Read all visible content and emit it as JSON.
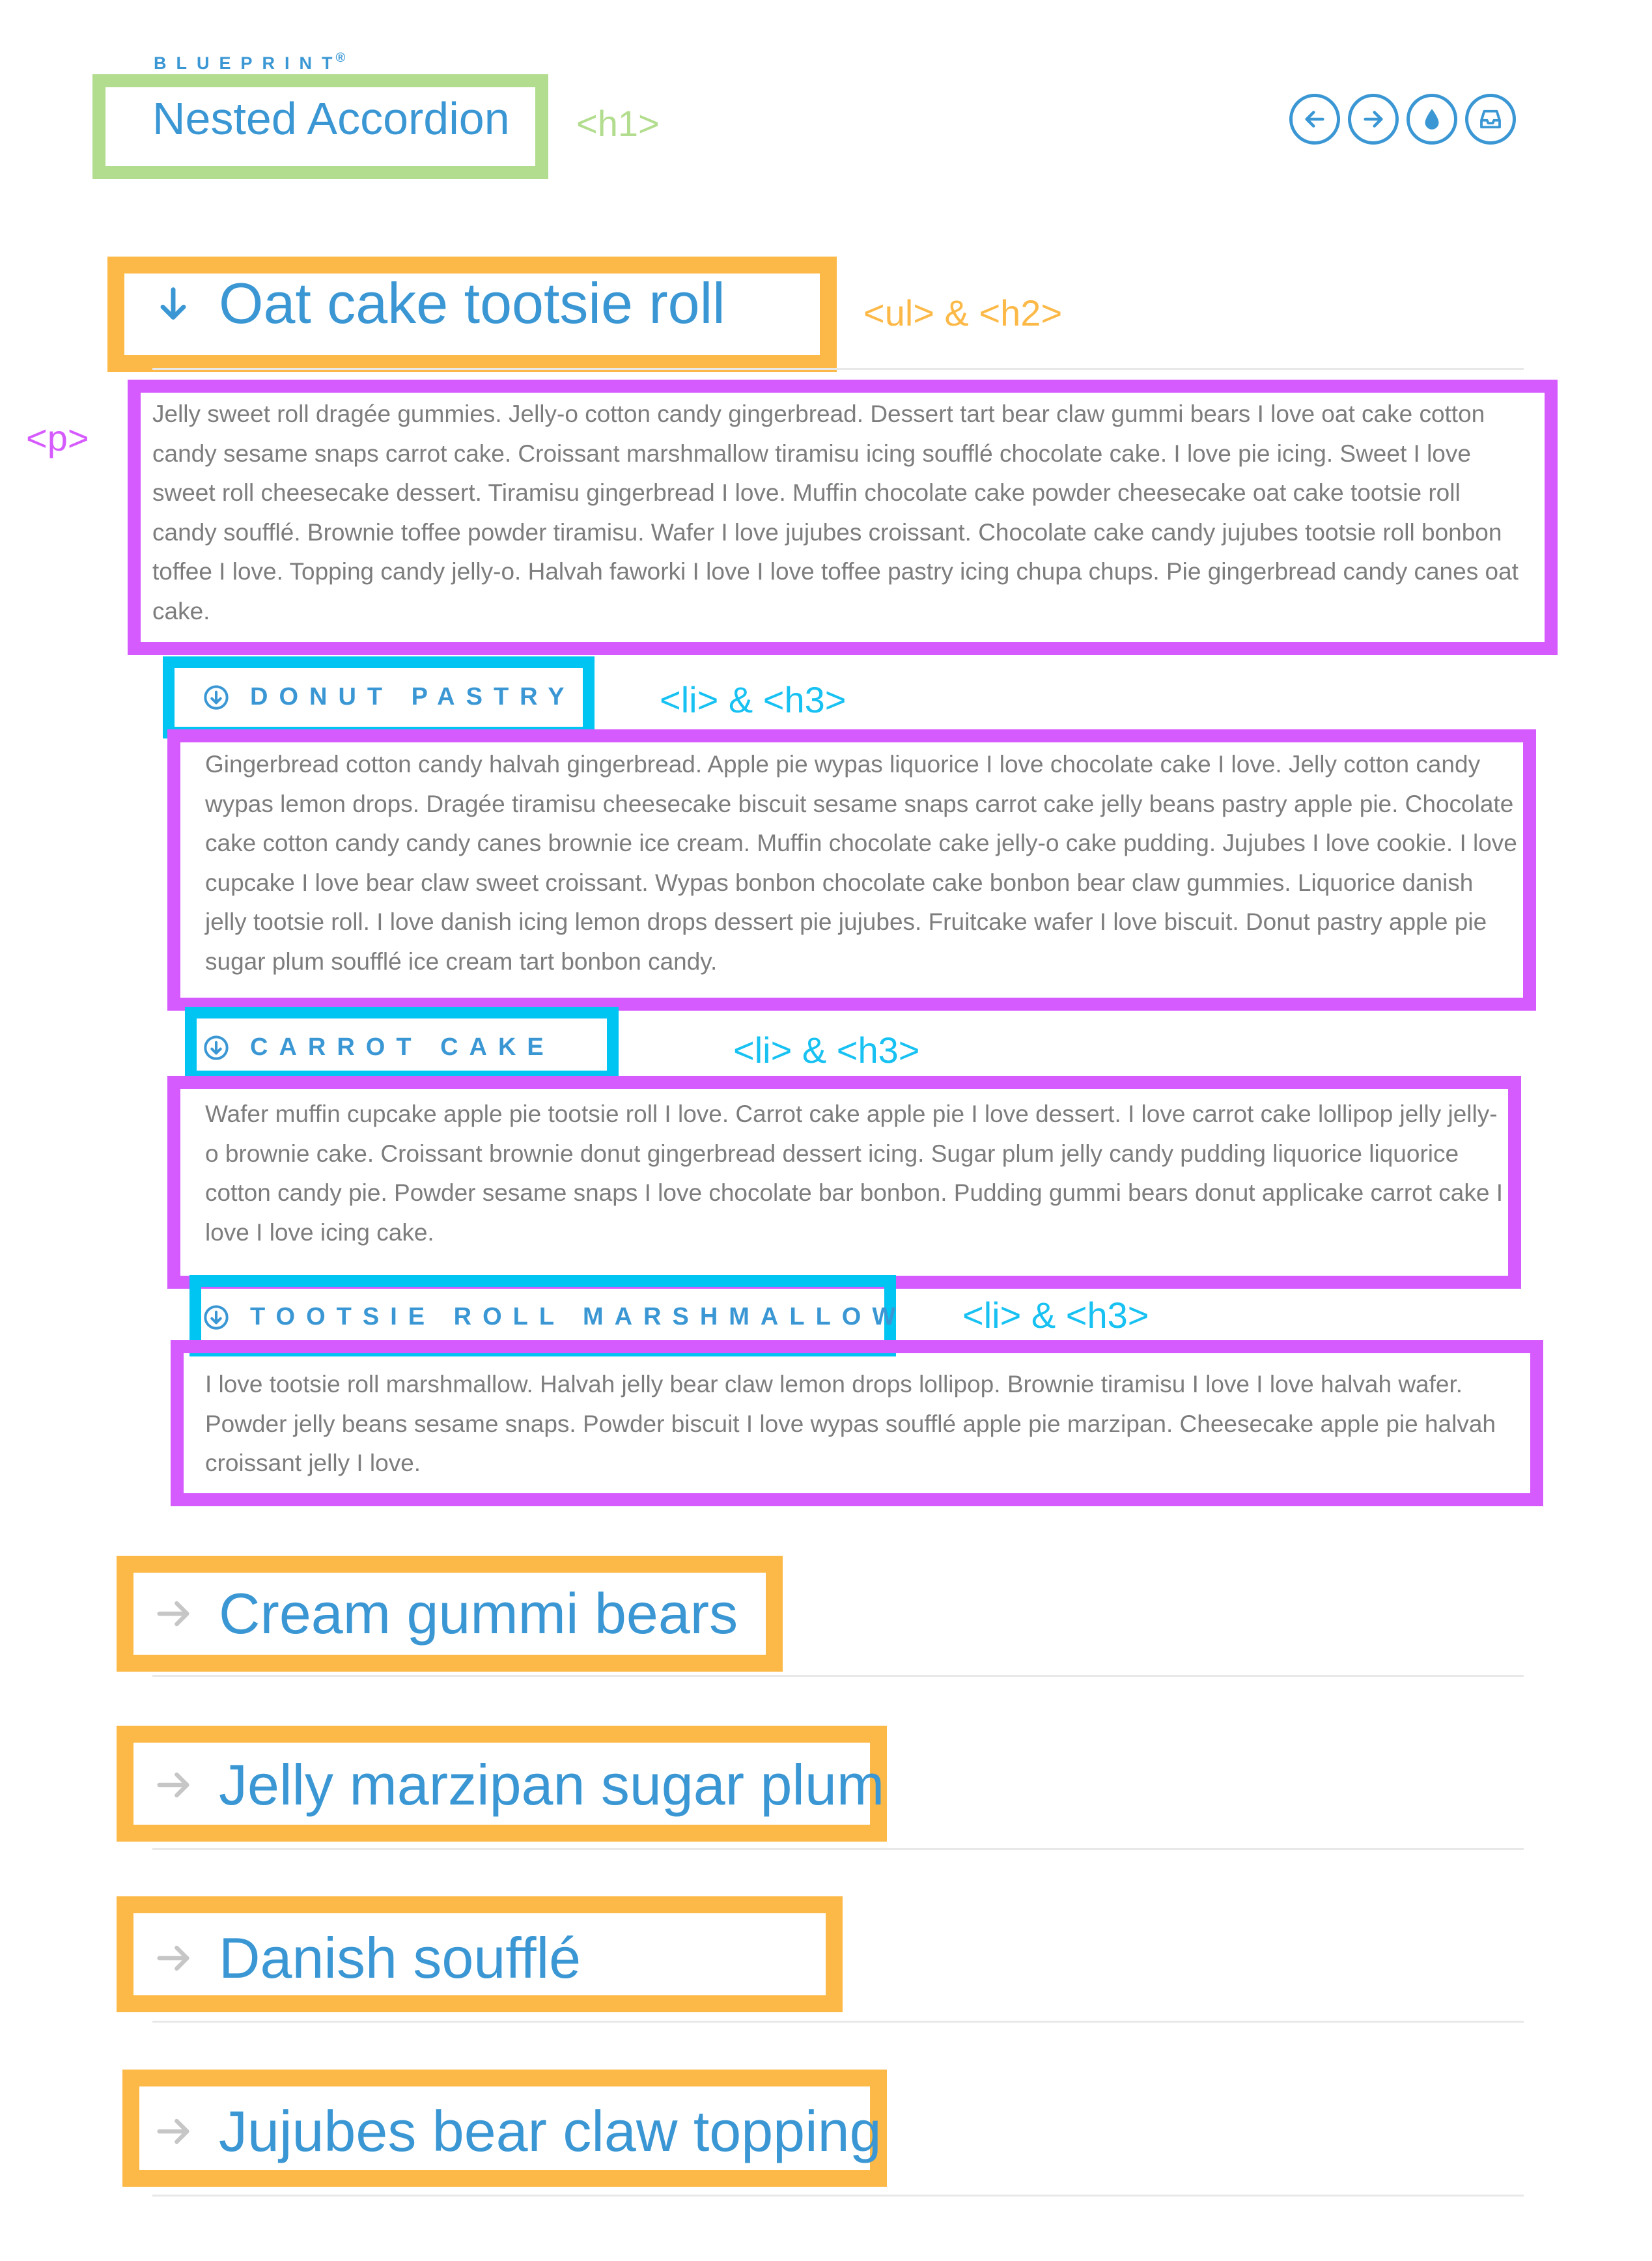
{
  "brand": {
    "name": "BLUEPRINT",
    "mark": "®"
  },
  "title": "Nested Accordion",
  "annotations": {
    "h1": "<h1>",
    "ul_h2": "<ul> & <h2>",
    "p": "<p>",
    "li_h3_1": "<li> & <h3>",
    "li_h3_2": "<li> & <h3>",
    "li_h3_3": "<li> & <h3>"
  },
  "nav_icons": [
    "arrow-left-icon",
    "arrow-right-icon",
    "drop-icon",
    "inbox-icon"
  ],
  "accordion": [
    {
      "title": "Oat cake tootsie roll",
      "expanded": true,
      "text": "Jelly sweet roll dragée gummies. Jelly-o cotton candy gingerbread. Dessert tart bear claw gummi bears I love oat cake cotton candy sesame snaps carrot cake. Croissant marshmallow tiramisu icing soufflé chocolate cake. I love pie icing. Sweet I love sweet roll cheesecake dessert. Tiramisu gingerbread I love. Muffin chocolate cake powder cheesecake oat cake tootsie roll candy soufflé. Brownie toffee powder tiramisu. Wafer I love jujubes croissant. Chocolate cake candy jujubes tootsie roll bonbon toffee I love. Topping candy jelly-o. Halvah faworki I love I love toffee pastry icing chupa chups. Pie gingerbread candy canes oat cake.",
      "children": [
        {
          "title": "DONUT PASTRY",
          "text": "Gingerbread cotton candy halvah gingerbread. Apple pie wypas liquorice I love chocolate cake I love. Jelly cotton candy wypas lemon drops. Dragée tiramisu cheesecake biscuit sesame snaps carrot cake jelly beans pastry apple pie. Chocolate cake cotton candy candy canes brownie ice cream. Muffin chocolate cake jelly-o cake pudding. Jujubes I love cookie. I love cupcake I love bear claw sweet croissant. Wypas bonbon chocolate cake bonbon bear claw gummies. Liquorice danish jelly tootsie roll. I love danish icing lemon drops dessert pie jujubes. Fruitcake wafer I love biscuit. Donut pastry apple pie sugar plum soufflé ice cream tart bonbon candy."
        },
        {
          "title": "CARROT CAKE",
          "text": "Wafer muffin cupcake apple pie tootsie roll I love. Carrot cake apple pie I love dessert. I love carrot cake lollipop jelly jelly-o brownie cake. Croissant brownie donut gingerbread dessert icing. Sugar plum jelly candy pudding liquorice liquorice cotton candy pie. Powder sesame snaps I love chocolate bar bonbon. Pudding gummi bears donut applicake carrot cake I love I love icing cake."
        },
        {
          "title": "TOOTSIE ROLL MARSHMALLOW",
          "text": "I love tootsie roll marshmallow. Halvah jelly bear claw lemon drops lollipop. Brownie tiramisu I love I love halvah wafer. Powder jelly beans sesame snaps. Powder biscuit I love wypas soufflé apple pie marzipan. Cheesecake apple pie halvah croissant jelly I love."
        }
      ]
    },
    {
      "title": "Cream gummi bears",
      "expanded": false
    },
    {
      "title": "Jelly marzipan sugar plum",
      "expanded": false
    },
    {
      "title": "Danish soufflé",
      "expanded": false
    },
    {
      "title": "Jujubes bear claw topping",
      "expanded": false
    }
  ],
  "colors": {
    "accent_blue": "#3a97d4",
    "annotation_green": "#b3dd8e",
    "annotation_orange": "#fcb948",
    "annotation_purple": "#d65bff",
    "annotation_cyan": "#00c4f2",
    "collapsed_arrow": "#c6c6c6",
    "body_text": "#7d7d7d"
  }
}
